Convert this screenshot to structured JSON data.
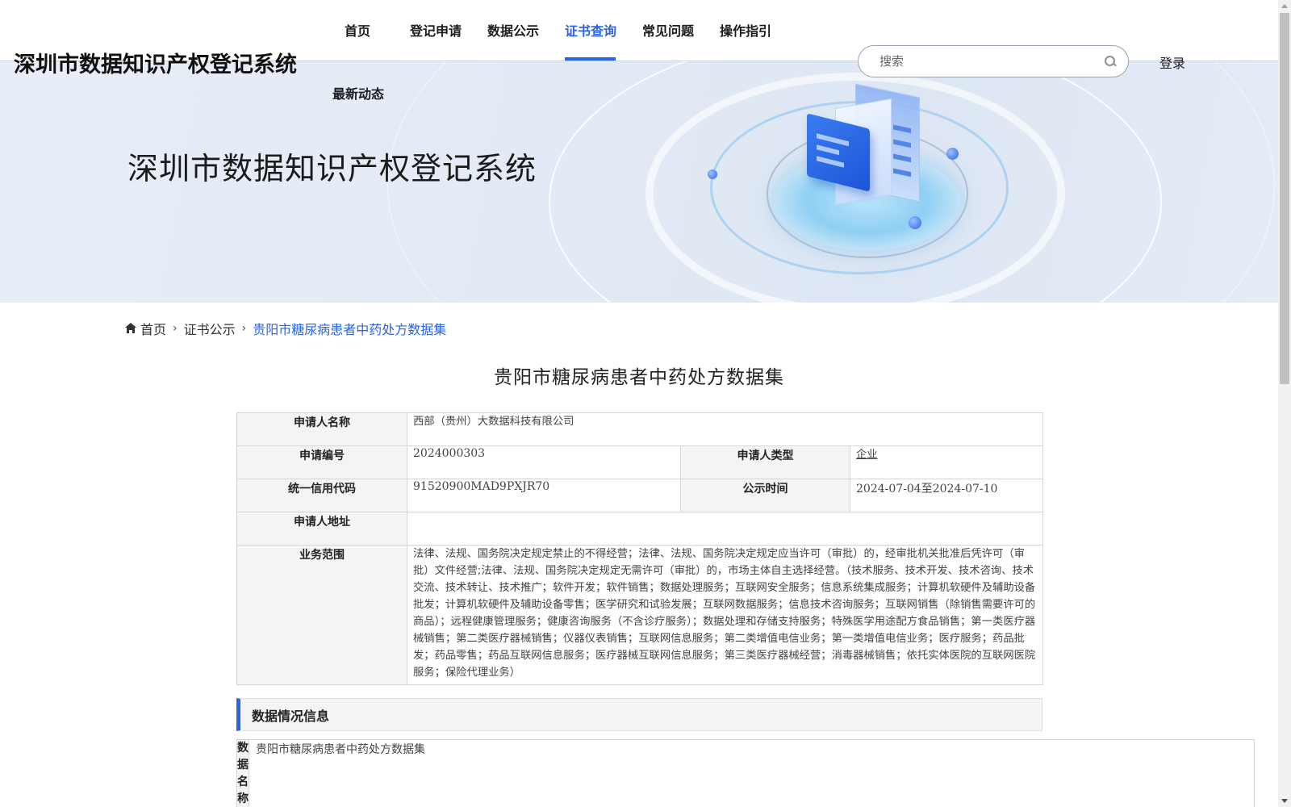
{
  "brand": "深圳市数据知识产权登记系统",
  "hero_title": "深圳市数据知识产权登记系统",
  "nav": {
    "items": [
      {
        "label": "首页"
      },
      {
        "label": "登记申请"
      },
      {
        "label": "数据公示"
      },
      {
        "label": "证书查询",
        "active": true
      },
      {
        "label": "常见问题"
      },
      {
        "label": "操作指引"
      },
      {
        "label": "最新动态"
      }
    ]
  },
  "search": {
    "placeholder": "搜索",
    "value": ""
  },
  "login_label": "登录",
  "breadcrumb": {
    "home": "首页",
    "parent": "证书公示",
    "current": "贵阳市糖尿病患者中药处方数据集"
  },
  "page_title": "贵阳市糖尿病患者中药处方数据集",
  "info": {
    "applicant_name_label": "申请人名称",
    "applicant_name": "西部（贵州）大数据科技有限公司",
    "application_no_label": "申请编号",
    "application_no": "2024000303",
    "applicant_type_label": "申请人类型",
    "applicant_type": "企业",
    "credit_code_label": "统一信用代码",
    "credit_code": "91520900MAD9PXJR70",
    "publicity_time_label": "公示时间",
    "publicity_time": "2024-07-04至2024-07-10",
    "address_label": "申请人地址",
    "address": "",
    "business_scope_label": "业务范围",
    "business_scope": "法律、法规、国务院决定规定禁止的不得经营；法律、法规、国务院决定规定应当许可（审批）的，经审批机关批准后凭许可（审批）文件经营;法律、法规、国务院决定规定无需许可（审批）的，市场主体自主选择经营。（技术服务、技术开发、技术咨询、技术交流、技术转让、技术推广；软件开发；软件销售；数据处理服务；互联网安全服务；信息系统集成服务；计算机软硬件及辅助设备批发；计算机软硬件及辅助设备零售；医学研究和试验发展；互联网数据服务；信息技术咨询服务；互联网销售（除销售需要许可的商品）；远程健康管理服务；健康咨询服务（不含诊疗服务）；数据处理和存储支持服务；特殊医学用途配方食品销售；第一类医疗器械销售；第二类医疗器械销售；仪器仪表销售；互联网信息服务；第二类增值电信业务；第一类增值电信业务；医疗服务；药品批发；药品零售；药品互联网信息服务；医疗器械互联网信息服务；第三类医疗器械经营；消毒器械销售；依托实体医院的互联网医院服务；保险代理业务）"
  },
  "data_section": {
    "title": "数据情况信息",
    "name_label": "数据名称",
    "name_value": "贵阳市糖尿病患者中药处方数据集"
  },
  "colors": {
    "accent": "#2a63e6",
    "label_bg": "#f4f4f4",
    "border": "#d6d6d6"
  }
}
